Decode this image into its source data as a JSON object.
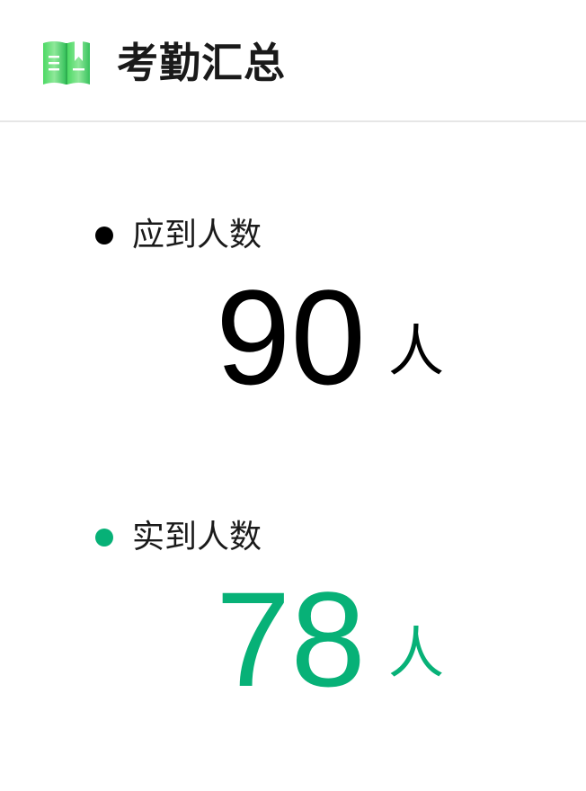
{
  "header": {
    "title": "考勤汇总",
    "icon": "open-book-icon"
  },
  "colors": {
    "expected": "#000000",
    "actual": "#07b177",
    "icon_green": "#3ecf6e",
    "divider": "#e6e6e6"
  },
  "expected": {
    "label": "应到人数",
    "value": "90",
    "unit": "人"
  },
  "actual": {
    "label": "实到人数",
    "value": "78",
    "unit": "人"
  }
}
